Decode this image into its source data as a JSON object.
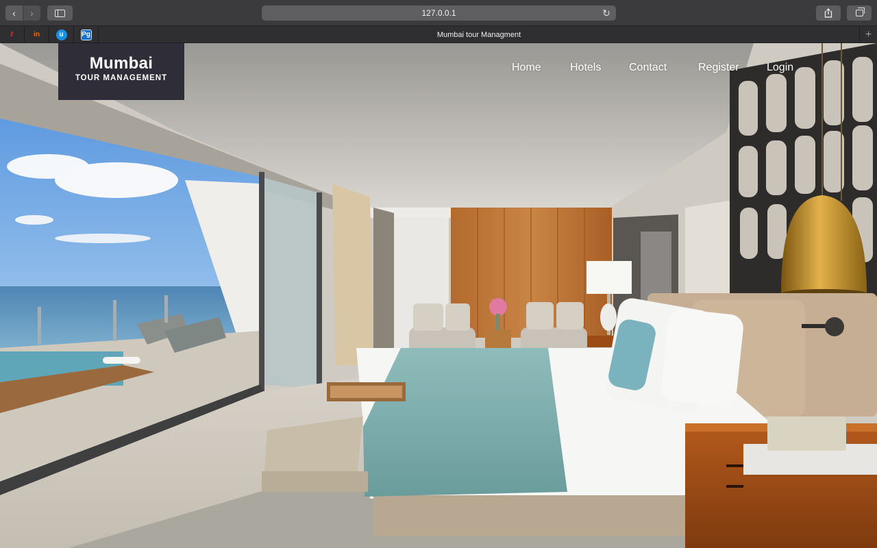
{
  "browser": {
    "url": "127.0.0.1",
    "tab_title": "Mumbai tour Managment",
    "favorites": [
      {
        "label": "t",
        "icon": "red-script-icon",
        "color": "#e2231a"
      },
      {
        "label": "in",
        "icon": "invision-icon",
        "color": "#ff6a00"
      },
      {
        "label": "u",
        "icon": "blue-circle-u-icon",
        "color": "#1e90e0"
      },
      {
        "label": "Pg",
        "icon": "pg-icon",
        "color": "#1a6fc9"
      }
    ],
    "back_glyph": "‹",
    "forward_glyph": "›",
    "reload_glyph": "↻",
    "share_glyph": "⇪",
    "new_tab_glyph": "+"
  },
  "brand": {
    "title": "Mumbai",
    "subtitle": "TOUR MANAGEMENT"
  },
  "nav": {
    "links": [
      "Home",
      "Hotels",
      "Contact",
      "Register",
      "Login"
    ]
  },
  "hero": {
    "image": "hotel-suite-ocean-view-photo"
  }
}
